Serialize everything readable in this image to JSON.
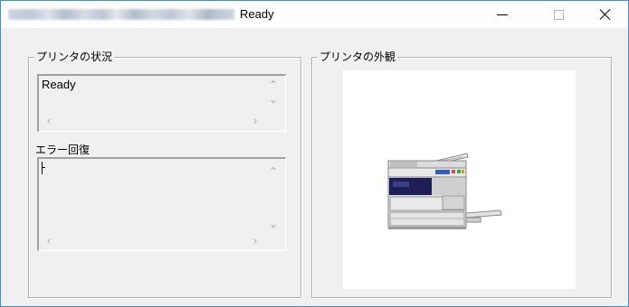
{
  "window": {
    "title": "Ready"
  },
  "groups": {
    "status": {
      "legend": "プリンタの状況",
      "text": "Ready"
    },
    "error_recovery": {
      "label": "エラー回復",
      "text": ""
    },
    "appearance": {
      "legend": "プリンタの外観"
    }
  },
  "icons": {
    "minimize": "minimize-icon",
    "maximize": "maximize-icon",
    "close": "close-icon",
    "scroll_up": "chevron-up-icon",
    "scroll_down": "chevron-down-icon",
    "scroll_left": "chevron-left-icon",
    "scroll_right": "chevron-right-icon",
    "printer": "multifunction-printer-icon"
  },
  "colors": {
    "window_border": "#3a8fd6",
    "background": "#f0f0f0",
    "printer_panel_bg": "#ffffff"
  }
}
